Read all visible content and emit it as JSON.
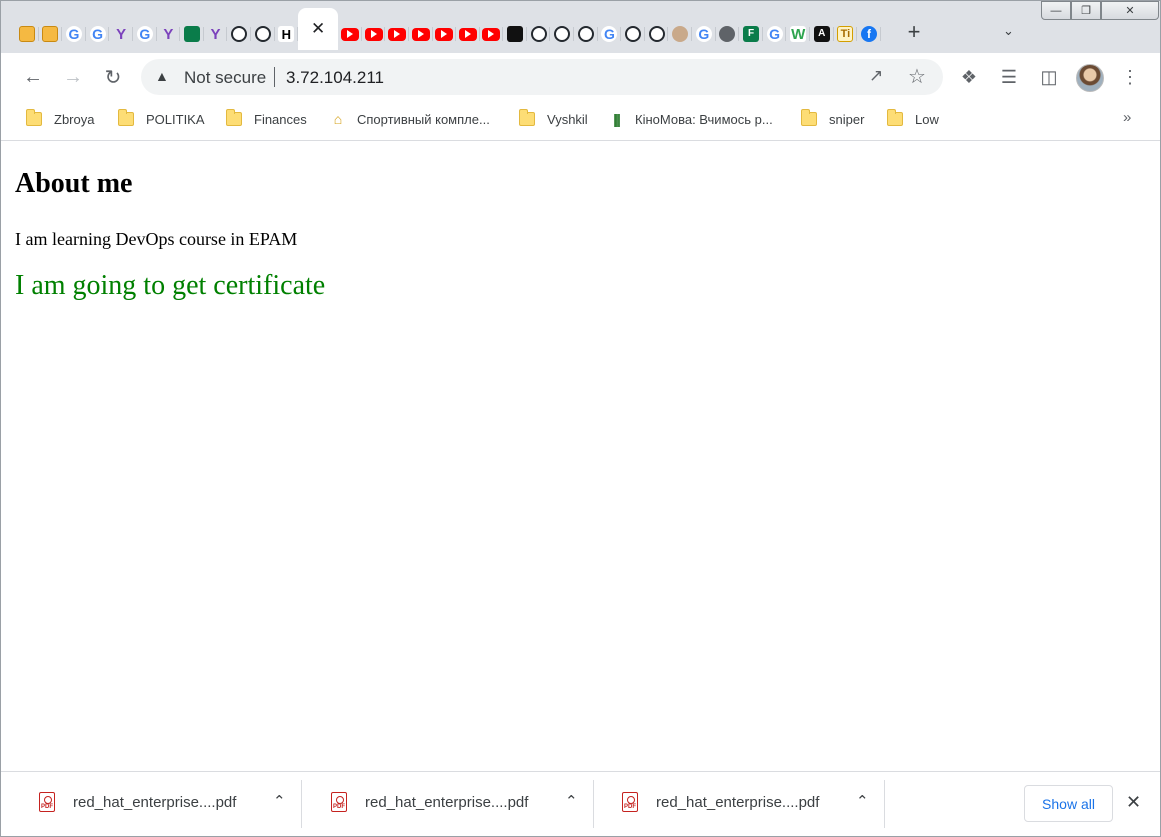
{
  "tabs": [
    {
      "icon": "amazon-box-icon",
      "type": "box"
    },
    {
      "icon": "amazon-box-icon",
      "type": "box"
    },
    {
      "icon": "google-icon",
      "type": "g",
      "glyph": "G"
    },
    {
      "icon": "google-icon",
      "type": "g",
      "glyph": "G"
    },
    {
      "icon": "terraform-icon",
      "type": "tf",
      "glyph": "Y"
    },
    {
      "icon": "google-icon",
      "type": "g",
      "glyph": "G"
    },
    {
      "icon": "terraform-icon",
      "type": "tf",
      "glyph": "Y"
    },
    {
      "icon": "hands-icon",
      "type": "ms"
    },
    {
      "icon": "terraform-icon",
      "type": "tf",
      "glyph": "Y"
    },
    {
      "icon": "github-icon",
      "type": "gh"
    },
    {
      "icon": "github-icon",
      "type": "gh"
    },
    {
      "icon": "hashicorp-icon",
      "type": "hc",
      "glyph": "H"
    },
    {
      "icon": "close-icon",
      "type": "active"
    },
    {
      "icon": "youtube-icon",
      "type": "yt"
    },
    {
      "icon": "youtube-icon",
      "type": "yt"
    },
    {
      "icon": "youtube-icon",
      "type": "yt"
    },
    {
      "icon": "youtube-icon",
      "type": "yt"
    },
    {
      "icon": "youtube-icon",
      "type": "yt"
    },
    {
      "icon": "youtube-icon",
      "type": "yt"
    },
    {
      "icon": "youtube-icon",
      "type": "yt"
    },
    {
      "icon": "dark-site-icon",
      "type": "dark"
    },
    {
      "icon": "github-icon",
      "type": "gh"
    },
    {
      "icon": "github-icon",
      "type": "gh"
    },
    {
      "icon": "github-icon",
      "type": "gh"
    },
    {
      "icon": "google-icon",
      "type": "g",
      "glyph": "G"
    },
    {
      "icon": "github-icon",
      "type": "gh"
    },
    {
      "icon": "github-icon",
      "type": "gh"
    },
    {
      "icon": "avatar-icon",
      "type": "avatar"
    },
    {
      "icon": "google-icon",
      "type": "g",
      "glyph": "G"
    },
    {
      "icon": "globe-icon",
      "type": "globe"
    },
    {
      "icon": "ms-forms-icon",
      "type": "ms",
      "glyph": "F"
    },
    {
      "icon": "google-icon",
      "type": "g",
      "glyph": "G"
    },
    {
      "icon": "w-icon",
      "type": "w",
      "glyph": "W"
    },
    {
      "icon": "dark-site-icon",
      "type": "dark",
      "glyph": "A"
    },
    {
      "icon": "ti-icon",
      "type": "ti",
      "glyph": "Ti"
    },
    {
      "icon": "facebook-icon",
      "type": "fb",
      "glyph": "f"
    }
  ],
  "toolbar": {
    "security_label": "Not secure",
    "url": "3.72.104.211"
  },
  "bookmarks": [
    {
      "label": "Zbroya",
      "icon": "folder-icon"
    },
    {
      "label": "POLITIKA",
      "icon": "folder-icon"
    },
    {
      "label": "Finances",
      "icon": "folder-icon"
    },
    {
      "label": "Спортивный компле...",
      "icon": "sport-site-icon"
    },
    {
      "label": "Vyshkil",
      "icon": "folder-icon"
    },
    {
      "label": "КіноМова: Вчимось р...",
      "icon": "audio-wave-icon"
    },
    {
      "label": "sniper",
      "icon": "folder-icon"
    },
    {
      "label": "Low",
      "icon": "folder-icon"
    }
  ],
  "page": {
    "heading": "About me",
    "line1": "I am learning DevOps course in EPAM",
    "line2": "I am going to get certificate",
    "line2_color": "#008000"
  },
  "downloads": {
    "items": [
      {
        "name": "red_hat_enterprise....pdf"
      },
      {
        "name": "red_hat_enterprise....pdf"
      },
      {
        "name": "red_hat_enterprise....pdf"
      }
    ],
    "show_all_label": "Show all"
  }
}
